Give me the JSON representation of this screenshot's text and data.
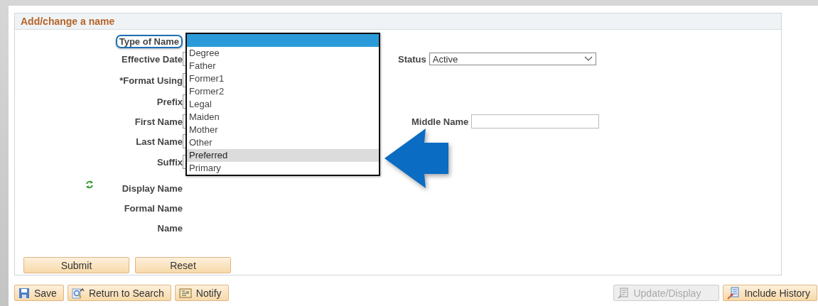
{
  "panel": {
    "title": "Add/change a name"
  },
  "fields": [
    {
      "label": "Type of Name",
      "highlighted": true,
      "kind": "dropdown"
    },
    {
      "label": "Effective Date",
      "highlighted": false,
      "kind": "input",
      "side": {
        "label": "Status",
        "kind": "select",
        "value": "Active"
      }
    },
    {
      "label": "*Format Using",
      "highlighted": false,
      "kind": "input"
    },
    {
      "label": "Prefix",
      "highlighted": false,
      "kind": "input"
    },
    {
      "label": "First Name",
      "highlighted": false,
      "kind": "input",
      "side": {
        "label": "Middle Name",
        "kind": "input"
      }
    },
    {
      "label": "Last Name",
      "highlighted": false,
      "kind": "input"
    },
    {
      "label": "Suffix",
      "highlighted": false,
      "kind": "input"
    },
    {
      "label": "Display Name",
      "highlighted": false,
      "kind": "refresh"
    },
    {
      "label": "Formal Name",
      "highlighted": false,
      "kind": "text"
    },
    {
      "label": "Name",
      "highlighted": false,
      "kind": "text"
    }
  ],
  "dropdown": {
    "options": [
      {
        "label": "Degree",
        "hovered": false
      },
      {
        "label": "Father",
        "hovered": false
      },
      {
        "label": "Former1",
        "hovered": false
      },
      {
        "label": "Former2",
        "hovered": false
      },
      {
        "label": "Legal",
        "hovered": false
      },
      {
        "label": "Maiden",
        "hovered": false
      },
      {
        "label": "Mother",
        "hovered": false
      },
      {
        "label": "Other",
        "hovered": false
      },
      {
        "label": "Preferred",
        "hovered": true
      },
      {
        "label": "Primary",
        "hovered": false
      }
    ]
  },
  "form_buttons": [
    "Submit",
    "Reset"
  ],
  "toolbar_left": [
    {
      "label": "Save",
      "disabled": false
    },
    {
      "label": "Return to Search",
      "disabled": false
    },
    {
      "label": "Notify",
      "disabled": false
    }
  ],
  "toolbar_right": [
    {
      "label": "Update/Display",
      "disabled": true
    },
    {
      "label": "Include History",
      "disabled": false
    }
  ]
}
